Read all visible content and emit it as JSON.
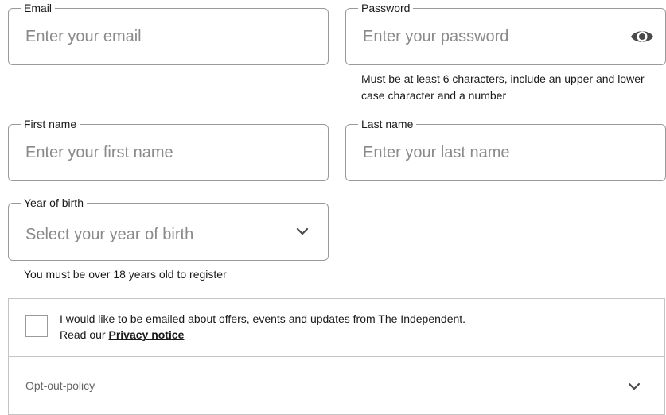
{
  "email": {
    "label": "Email",
    "placeholder": "Enter your email"
  },
  "password": {
    "label": "Password",
    "placeholder": "Enter your password",
    "icon": "eye-icon",
    "helper": "Must be at least 6 characters, include an upper and lower case character and a number"
  },
  "first_name": {
    "label": "First name",
    "placeholder": "Enter your first name"
  },
  "last_name": {
    "label": "Last name",
    "placeholder": "Enter your last name"
  },
  "year_of_birth": {
    "label": "Year of birth",
    "placeholder": "Select your year of birth",
    "icon": "chevron-down-icon",
    "helper": "You must be over 18 years old to register"
  },
  "consent": {
    "text": "I would like to be emailed about offers, events and updates from The Independent.",
    "read_prefix": "Read our",
    "privacy_link": "Privacy notice"
  },
  "opt_out": {
    "label": "Opt-out-policy",
    "icon": "chevron-down-icon"
  },
  "colors": {
    "border": "#9a9a9a",
    "placeholder": "#8a8a8a",
    "text": "#1a1a1a",
    "divider": "#c4c4c4"
  }
}
